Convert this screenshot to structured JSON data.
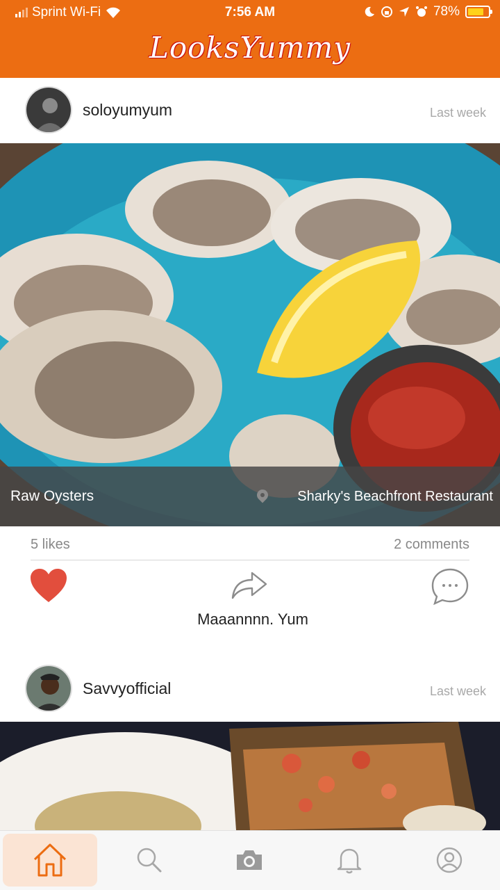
{
  "status_bar": {
    "carrier": "Sprint Wi-Fi",
    "time": "7:56 AM",
    "battery": "78%",
    "battery_level": 0.78
  },
  "app": {
    "title": "LooksYummy"
  },
  "posts": [
    {
      "username": "soloyumyum",
      "time": "Last week",
      "dish": "Raw Oysters",
      "restaurant": "Sharky's Beachfront Restaurant",
      "likes": "5 likes",
      "comments": "2 comments",
      "liked": true,
      "text": "Maaannnn. Yum"
    },
    {
      "username": "Savvyofficial",
      "time": "Last week"
    }
  ],
  "colors": {
    "brand": "#ec6d12",
    "like": "#e24e3d",
    "active_tab_bg": "#fbe4d4"
  },
  "nav": {
    "tabs": [
      {
        "icon": "home-icon",
        "active": true
      },
      {
        "icon": "search-icon",
        "active": false
      },
      {
        "icon": "camera-icon",
        "active": false
      },
      {
        "icon": "bell-icon",
        "active": false
      },
      {
        "icon": "profile-icon",
        "active": false
      }
    ]
  }
}
